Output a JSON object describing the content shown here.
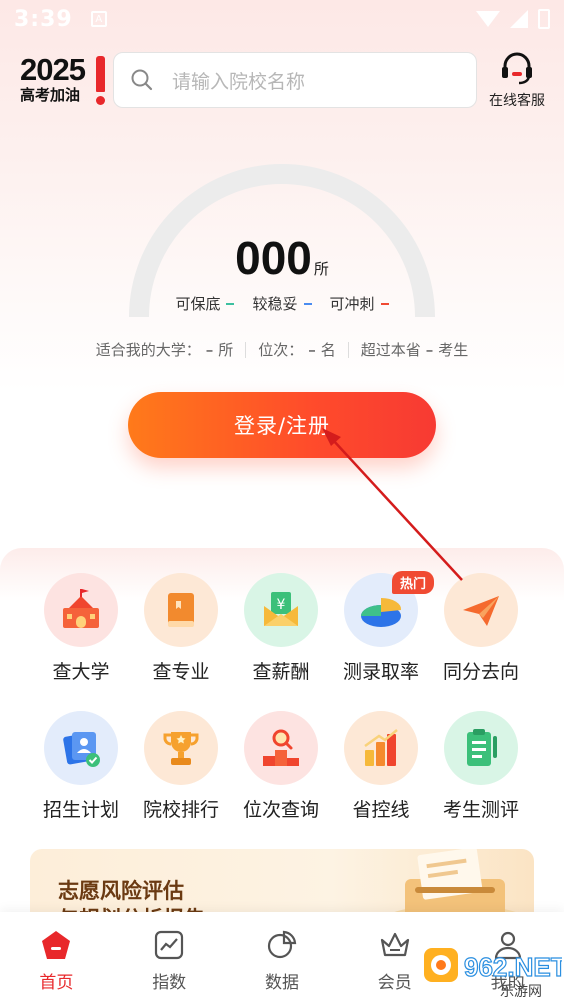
{
  "status_bar": {
    "time": "3:39"
  },
  "header": {
    "logo_year": "2025",
    "logo_subtitle": "高考加油",
    "search_placeholder": "请输入院校名称",
    "customer_service_label": "在线客服"
  },
  "gauge": {
    "count": "000",
    "unit": "所",
    "legend": [
      {
        "label": "可保底",
        "color": "#3cc0a0"
      },
      {
        "label": "较稳妥",
        "color": "#4a8cf0"
      },
      {
        "label": "可冲刺",
        "color": "#f04a32"
      }
    ]
  },
  "stats": {
    "suitable_label": "适合我的大学：",
    "suitable_value": "–",
    "suitable_unit": "所",
    "rank_label": "位次：",
    "rank_value": "–",
    "rank_unit": "名",
    "exceed_label": "超过本省",
    "exceed_value": "–",
    "exceed_unit": "考生"
  },
  "login_button": "登录/注册",
  "tools": [
    {
      "label": "查大学",
      "icon": "school-icon"
    },
    {
      "label": "查专业",
      "icon": "book-icon"
    },
    {
      "label": "查薪酬",
      "icon": "salary-envelope-icon"
    },
    {
      "label": "测录取率",
      "icon": "pie-chart-icon",
      "badge": "热门"
    },
    {
      "label": "同分去向",
      "icon": "paper-plane-icon"
    },
    {
      "label": "招生计划",
      "icon": "enrollment-plan-icon"
    },
    {
      "label": "院校排行",
      "icon": "trophy-icon"
    },
    {
      "label": "位次查询",
      "icon": "rank-search-icon"
    },
    {
      "label": "省控线",
      "icon": "bar-chart-icon"
    },
    {
      "label": "考生测评",
      "icon": "clipboard-icon"
    }
  ],
  "banner": {
    "title": "志愿风险评估",
    "subtitle": "与规划分析报告"
  },
  "bottom_nav": [
    {
      "label": "首页",
      "icon": "home-icon",
      "active": true
    },
    {
      "label": "指数",
      "icon": "index-chart-icon",
      "active": false
    },
    {
      "label": "数据",
      "icon": "data-pie-icon",
      "active": false
    },
    {
      "label": "会员",
      "icon": "crown-icon",
      "active": false
    },
    {
      "label": "我的",
      "icon": "user-icon",
      "active": false
    }
  ],
  "watermark": {
    "text": "962.NET",
    "subtext": "乐游网"
  },
  "colors": {
    "brand_red": "#e8282b",
    "button_start": "#ff7a1a",
    "button_end": "#f73a33"
  }
}
